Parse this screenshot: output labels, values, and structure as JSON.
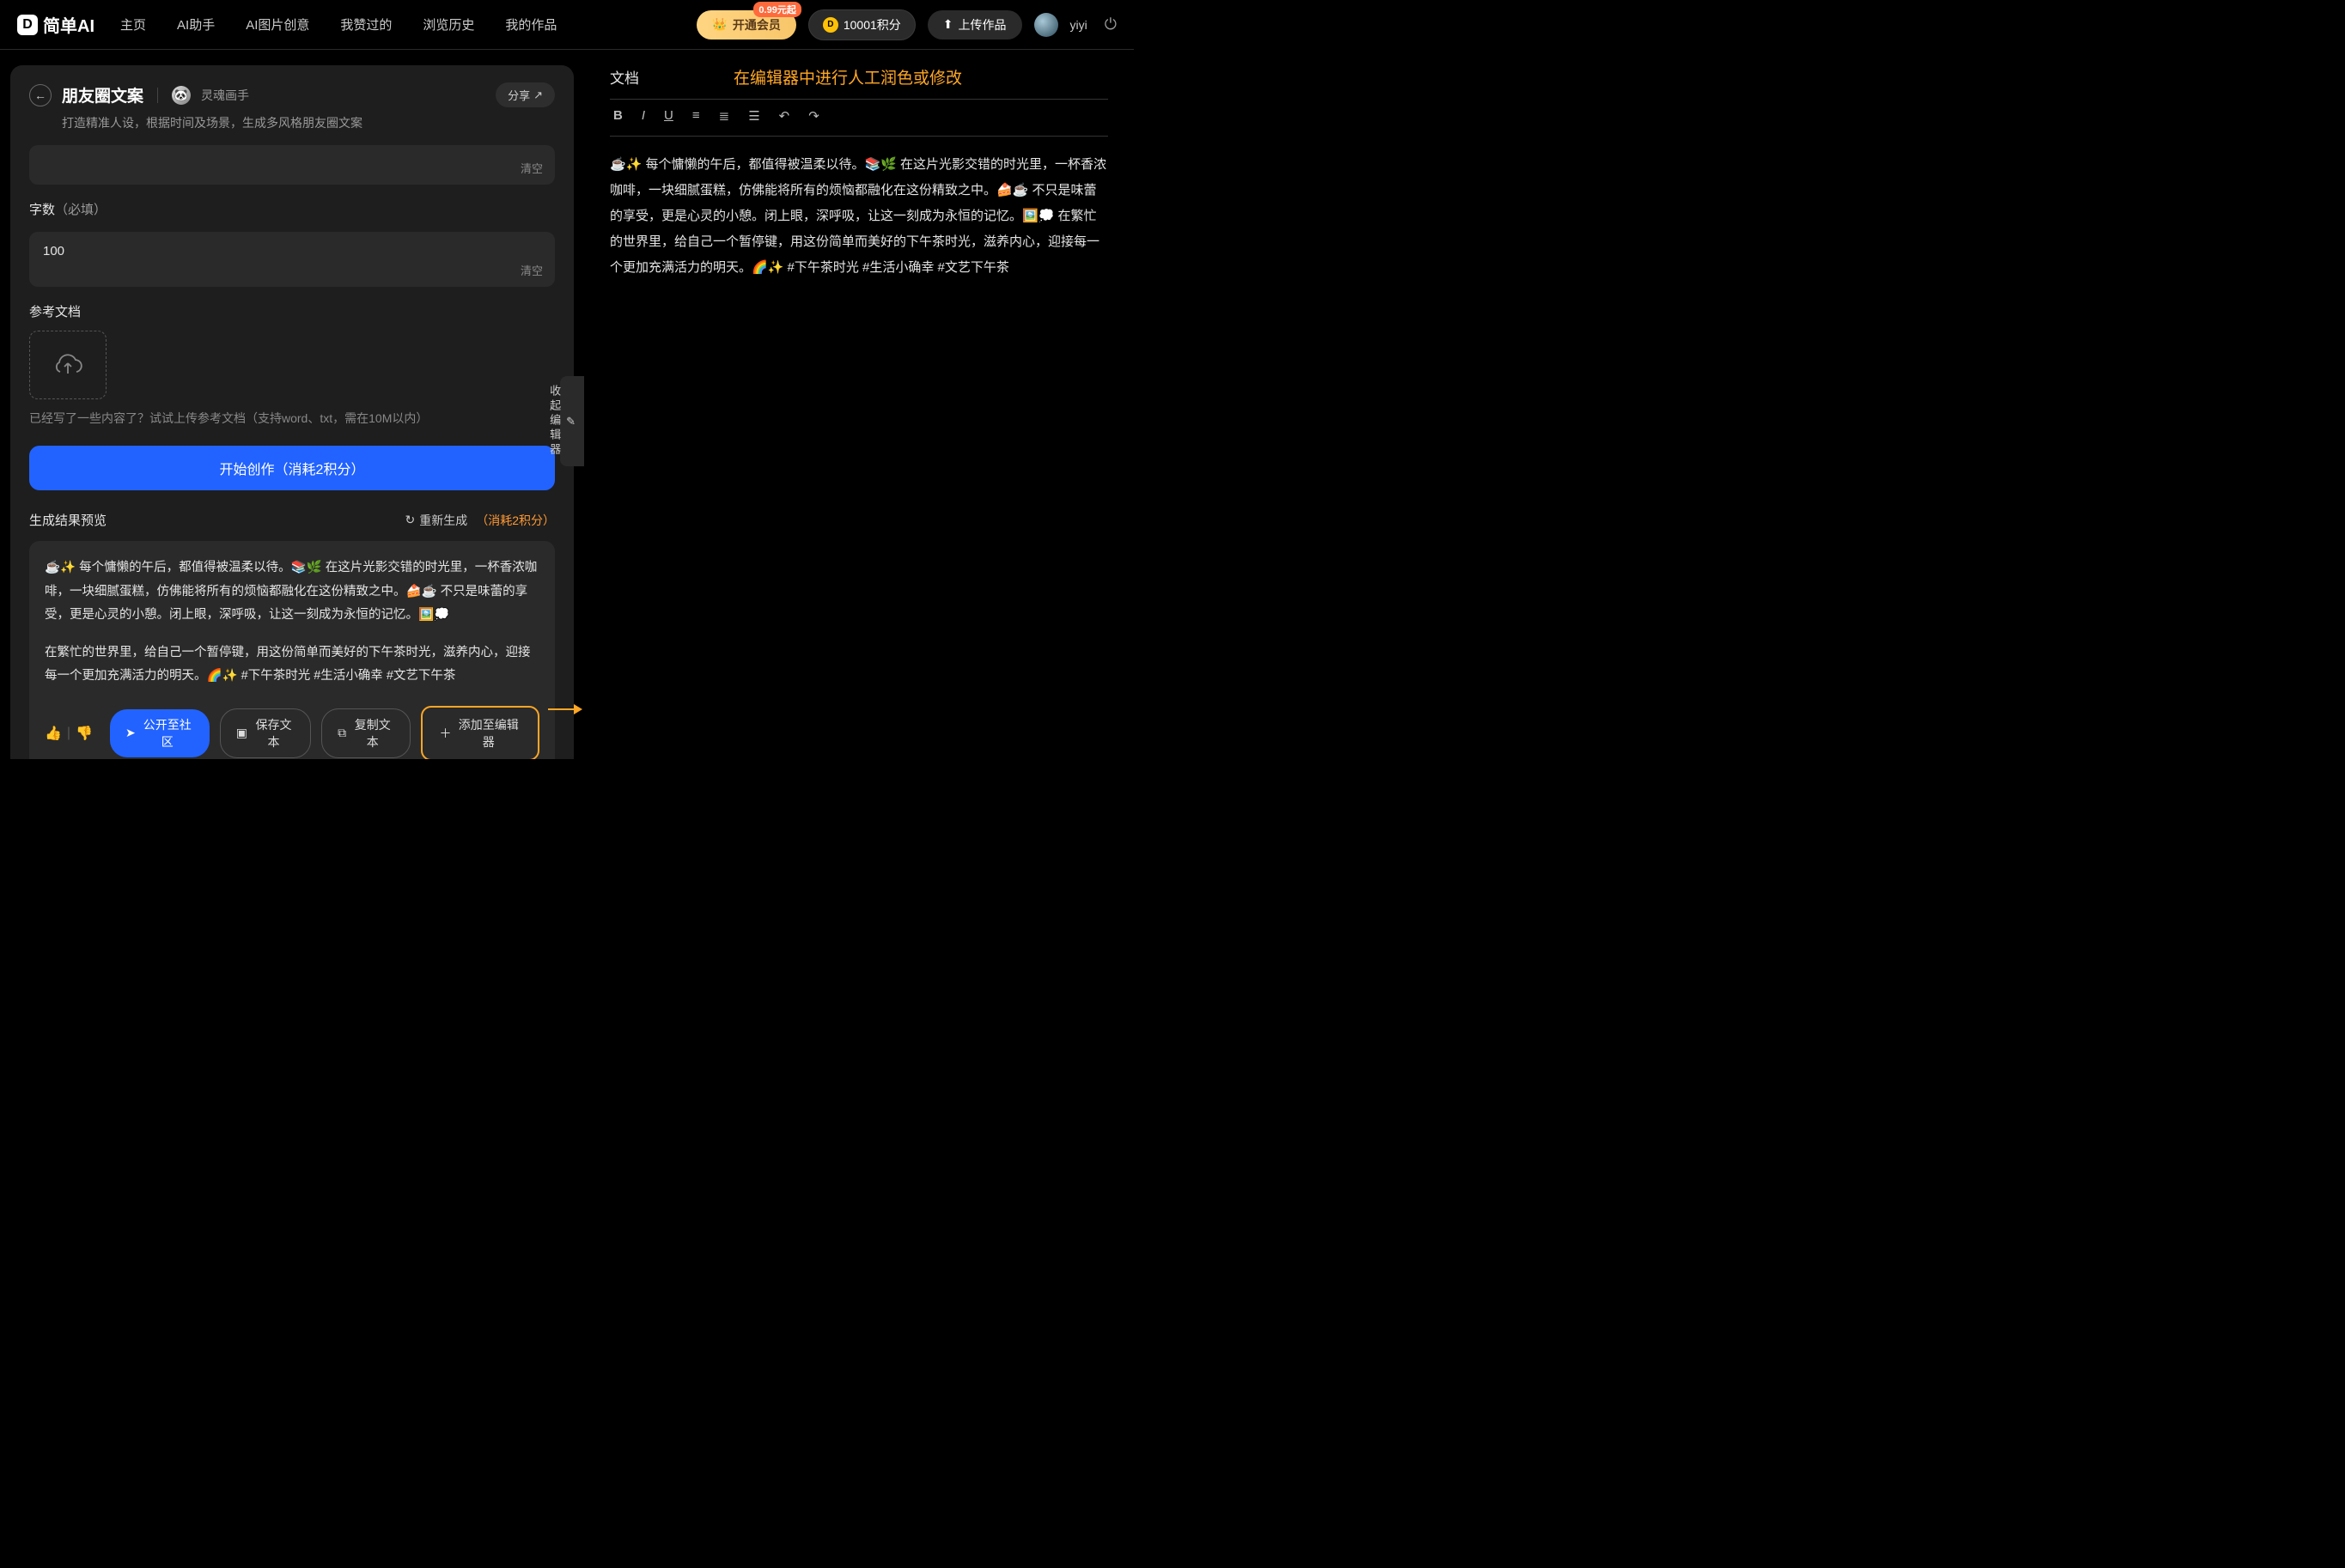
{
  "header": {
    "logo": "简单AI",
    "nav": [
      "主页",
      "AI助手",
      "AI图片创意",
      "我赞过的",
      "浏览历史",
      "我的作品"
    ],
    "vip_label": "开通会员",
    "vip_badge": "0.99元起",
    "points": "10001积分",
    "upload": "上传作品",
    "username": "yiyi"
  },
  "card": {
    "title": "朋友圈文案",
    "author": "灵魂画手",
    "share": "分享",
    "subtitle": "打造精准人设，根据时间及场景，生成多风格朋友圈文案",
    "clear": "清空",
    "wordcount_label": "字数",
    "required": "（必填）",
    "wordcount_value": "100",
    "ref_label": "参考文档",
    "upload_hint": "已经写了一些内容了？试试上传参考文档（支持word、txt，需在10M以内）",
    "start_btn": "开始创作（消耗2积分）"
  },
  "preview": {
    "title": "生成结果预览",
    "regen": "重新生成",
    "cost": "（消耗2积分）",
    "para1": "☕✨ 每个慵懒的午后，都值得被温柔以待。📚🌿 在这片光影交错的时光里，一杯香浓咖啡，一块细腻蛋糕，仿佛能将所有的烦恼都融化在这份精致之中。🍰☕ 不只是味蕾的享受，更是心灵的小憩。闭上眼，深呼吸，让这一刻成为永恒的记忆。🖼️💭",
    "para2": "在繁忙的世界里，给自己一个暂停键，用这份简单而美好的下午茶时光，滋养内心，迎接每一个更加充满活力的明天。🌈✨ #下午茶时光 #生活小确幸 #文艺下午茶",
    "publish": "公开至社区",
    "save_text": "保存文本",
    "copy_text": "复制文本",
    "add_editor": "添加至编辑器"
  },
  "editor": {
    "doc_label": "文档",
    "hint": "在编辑器中进行人工润色或修改",
    "content": "☕✨ 每个慵懒的午后，都值得被温柔以待。📚🌿 在这片光影交错的时光里，一杯香浓咖啡，一块细腻蛋糕，仿佛能将所有的烦恼都融化在这份精致之中。🍰☕ 不只是味蕾的享受，更是心灵的小憩。闭上眼，深呼吸，让这一刻成为永恒的记忆。🖼️💭 在繁忙的世界里，给自己一个暂停键，用这份简单而美好的下午茶时光，滋养内心，迎接每一个更加充满活力的明天。🌈✨ #下午茶时光 #生活小确幸 #文艺下午茶",
    "collapse": "收起编辑器"
  }
}
